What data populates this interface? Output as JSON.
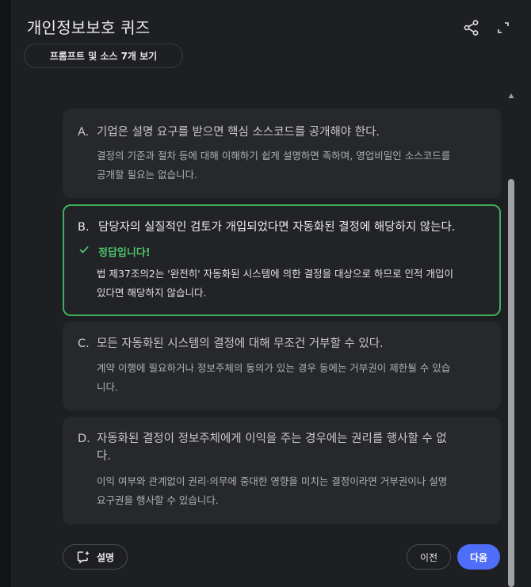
{
  "header": {
    "title": "개인정보보호 퀴즈",
    "chip_label": "프롬프트 및 소스 7개 보기",
    "share_icon": "share-icon",
    "expand_icon": "expand-icon"
  },
  "options": [
    {
      "letter": "A.",
      "question": "기업은 설명 요구를 받으면 핵심 소스코드를 공개해야 한다.",
      "explanation_line1": "결정의 기준과 절차 등에 대해 이해하기 쉽게 설명하면 족하며, 영업비밀인 소스코드를",
      "explanation_line2": "공개할 필요는 없습니다."
    },
    {
      "letter": "B.",
      "question": "담당자의 실질적인 검토가 개입되었다면 자동화된 결정에 해당하지 않는다.",
      "status": "정답입니다!",
      "explanation_line1": "법 제37조의2는 '완전히' 자동화된 시스템에 의한 결정을 대상으로 하므로 인적 개입이",
      "explanation_line2": "있다면 해당하지 않습니다."
    },
    {
      "letter": "C.",
      "question": "모든 자동화된 시스템의 결정에 대해 무조건 거부할 수 있다.",
      "explanation_line1": "계약 이행에 필요하거나 정보주체의 동의가 있는 경우 등에는 거부권이 제한될 수 있습",
      "explanation_line2": "니다."
    },
    {
      "letter": "D.",
      "question_line1": "자동화된 결정이 정보주체에게 이익을 주는 경우에는 권리를 행사할 수 없",
      "question_line2": "다.",
      "explanation_line1": "이익 여부와 관계없이 권리·의무에 중대한 영향을 미치는 결정이라면 거부권이나 설명",
      "explanation_line2": "요구권을 행사할 수 있습니다."
    }
  ],
  "footer": {
    "explain_label": "설명",
    "prev_label": "이전",
    "next_label": "다음"
  },
  "colors": {
    "accent": "#4f6ef7",
    "correct": "#3fae5b",
    "background": "#1e1f22",
    "card": "#27282c"
  }
}
